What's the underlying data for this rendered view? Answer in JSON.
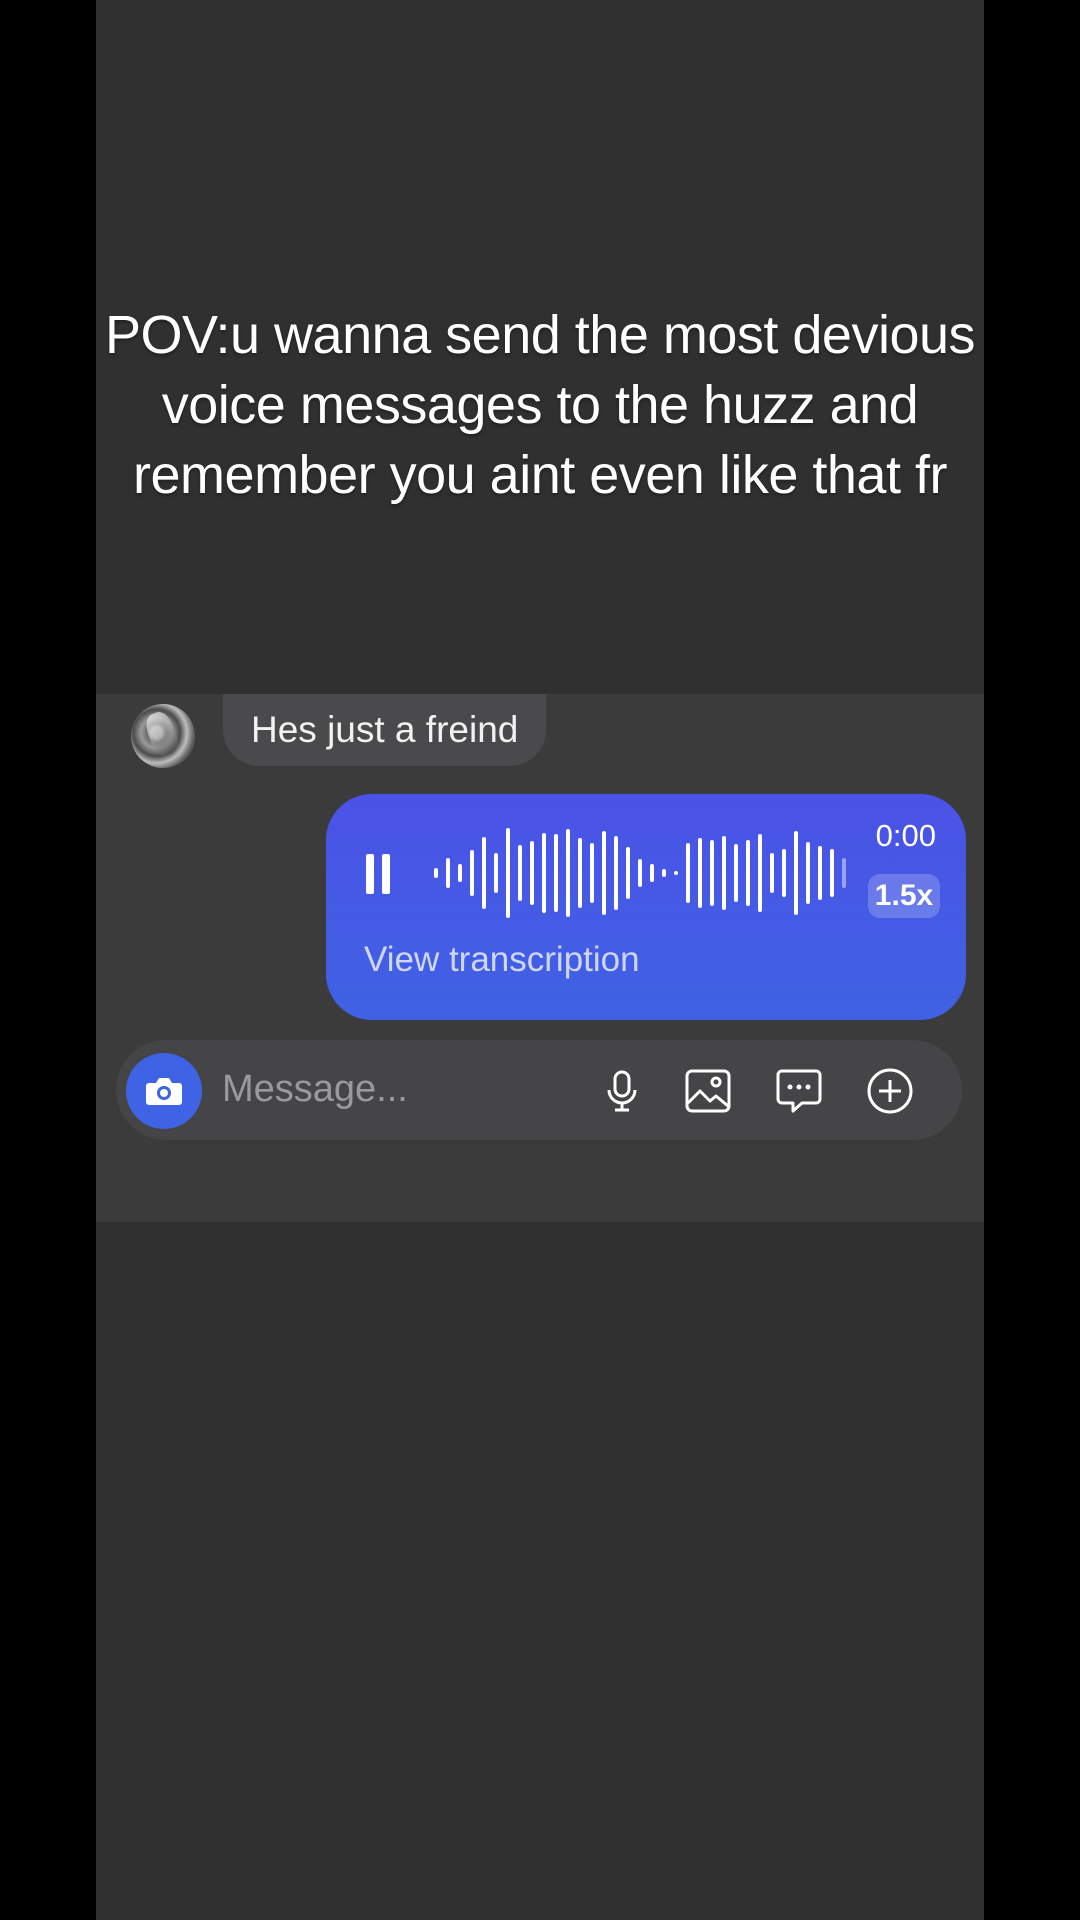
{
  "caption": "POV:u wanna send the most devious voice messages to the huzz and remember you aint even like that fr",
  "incoming_message": "Hes just a freind",
  "voice_message": {
    "duration": "0:00",
    "speed": "1.5x",
    "transcription_label": "View transcription"
  },
  "composer": {
    "placeholder": "Message..."
  },
  "colors": {
    "voice_bubble": "#4453e6",
    "camera_button": "#3e63e4"
  },
  "icons": [
    "camera-icon",
    "microphone-icon",
    "gallery-icon",
    "sticker-icon",
    "plus-icon",
    "pause-icon"
  ]
}
